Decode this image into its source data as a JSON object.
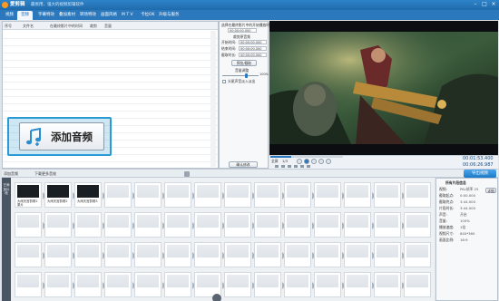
{
  "app": {
    "name": "爱剪辑",
    "subtitle": "最易用、强大的视频剪辑软件",
    "window_controls": [
      "–",
      "□",
      "×"
    ]
  },
  "menu": {
    "tabs": [
      {
        "label": "视频",
        "active": false
      },
      {
        "label": "音频",
        "active": true
      },
      {
        "label": "字幕特效",
        "active": false
      },
      {
        "label": "叠加素材",
        "active": false
      },
      {
        "label": "转场特效",
        "active": false
      },
      {
        "label": "画面风格",
        "active": false
      },
      {
        "label": "M T V",
        "active": false
      },
      {
        "label": "卡拉OK",
        "active": false
      },
      {
        "label": "升级与服务",
        "active": false
      }
    ]
  },
  "audio_list": {
    "columns": [
      "序号",
      "文件名",
      "在最终影片中的时间",
      "裁剪",
      "音量"
    ]
  },
  "settings": {
    "heading": "选择在最终影片中的开始播放时间",
    "time_value": "00:00:00.000",
    "cut_heading": "裁剪原音频",
    "start_label": "开始时间:",
    "end_label": "结束时间:",
    "duration_label": "截取时长:",
    "start_value": "00:00:00.000",
    "end_value": "00:00:00.000",
    "duration_value": "00:00:00.000",
    "preview_button": "预览/截取",
    "volume_heading": "音量调整",
    "volume_value": "100%",
    "fade_label": "头尾声音淡入淡出",
    "confirm_button": "确认修改"
  },
  "player": {
    "time_current": "00:01:53.400",
    "time_total": "00:06:26.987",
    "playback_progress": 0.29,
    "scale_label": "1/3",
    "fullscreen_label": "全屏"
  },
  "toolbar": {
    "add_audio": "添加音频",
    "download_audio": "下载更多音效",
    "export_label": "导出视频"
  },
  "callout": {
    "label": "添加音频"
  },
  "timeline": {
    "strip_label": "已添加片段",
    "clips": [
      {
        "name": "大闹天宫剪辑1",
        "sub": "原片"
      },
      {
        "name": "大闹天宫剪辑2",
        "sub": ""
      },
      {
        "name": "大闹天宫剪辑3",
        "sub": ""
      }
    ]
  },
  "properties": {
    "title": "所有片段信息",
    "rows": [
      {
        "key": "视频:",
        "value": "PAL帧率 25",
        "tag": "详细"
      },
      {
        "key": "截取起点:",
        "value": "0:00.000"
      },
      {
        "key": "截取终点:",
        "value": "3:44.000"
      },
      {
        "key": "片段时长:",
        "value": "3:44.000"
      },
      {
        "key": "声音:",
        "value": "开启"
      },
      {
        "key": "音量:",
        "value": "100%"
      },
      {
        "key": "播放速度:",
        "value": "1倍"
      },
      {
        "key": "视频尺寸:",
        "value": "640*360"
      },
      {
        "key": "画面比例:",
        "value": "16:9"
      }
    ]
  },
  "colors": {
    "accent": "#2b78bd",
    "callout_border": "#2a9ad4",
    "export": "#1d79c7"
  }
}
